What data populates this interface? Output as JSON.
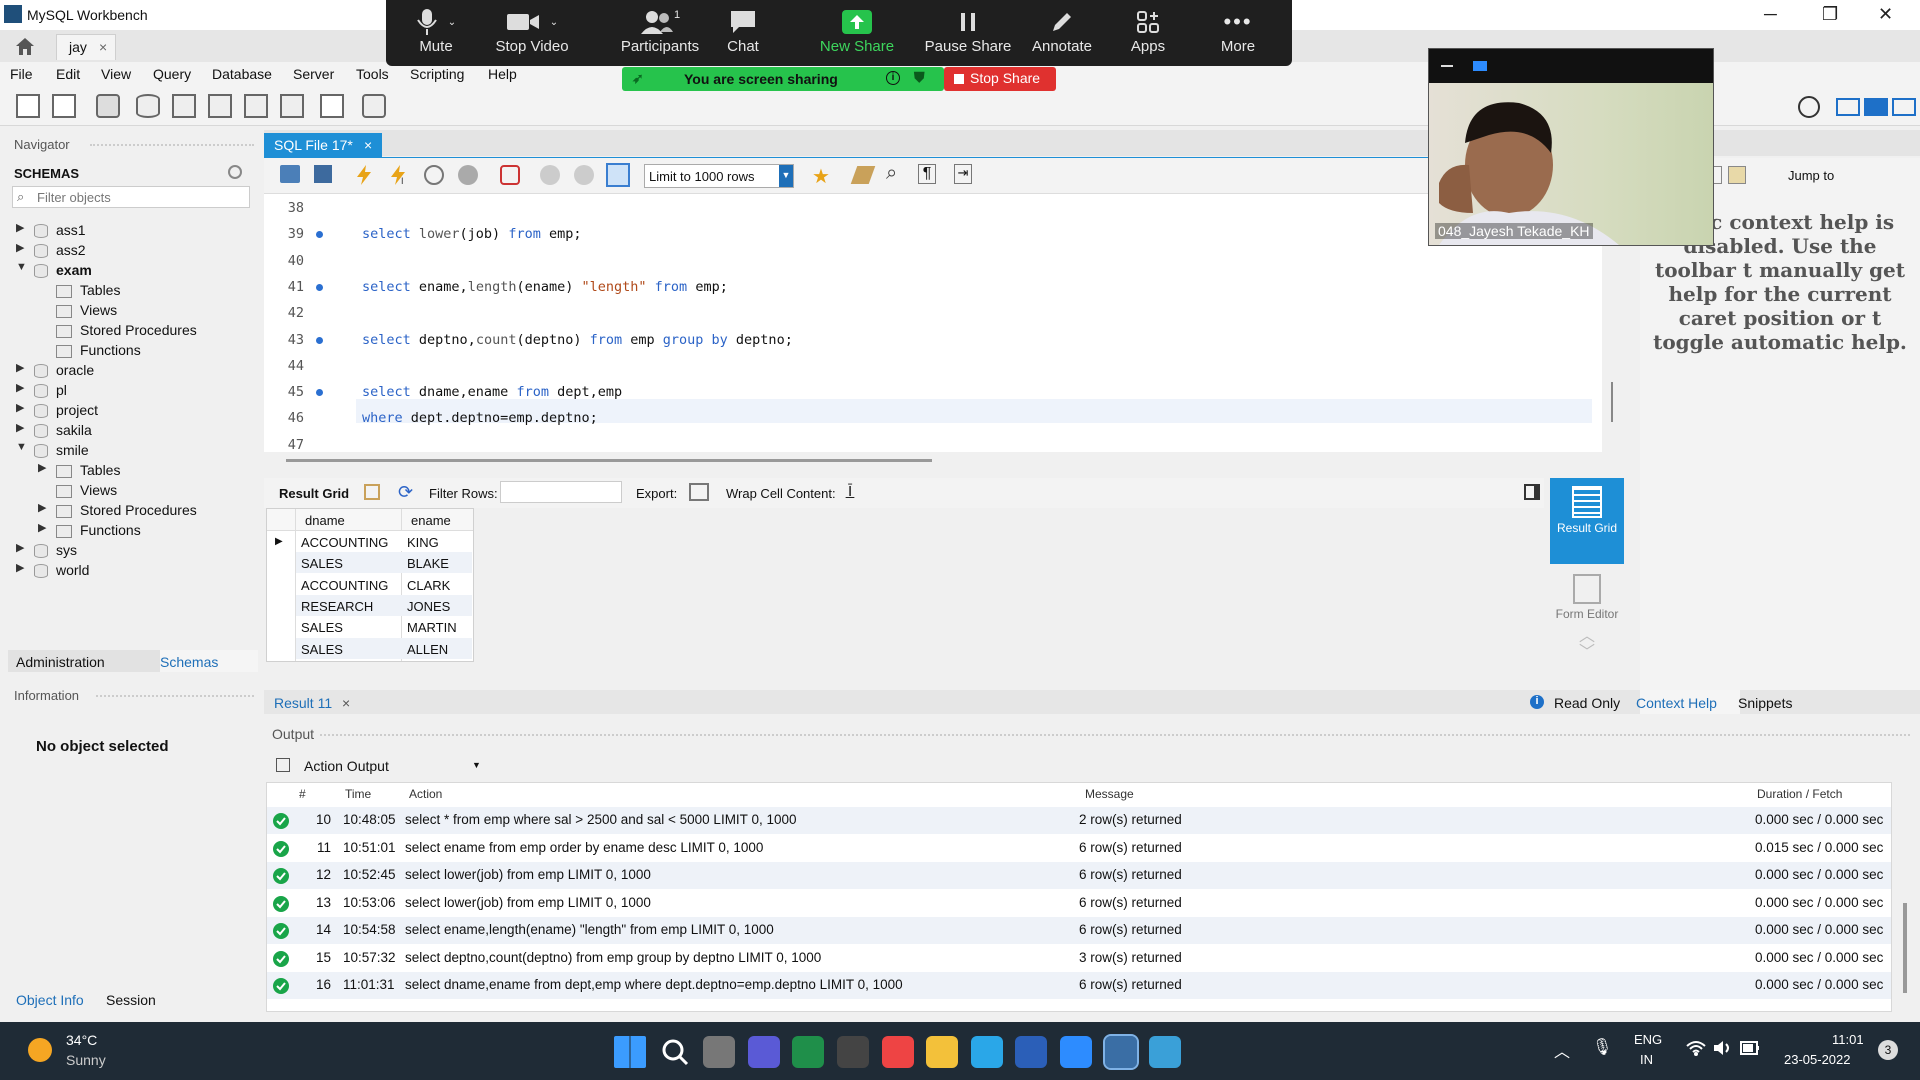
{
  "window": {
    "title": "MySQL Workbench",
    "conn_tab": "jay"
  },
  "zoom": {
    "buttons": [
      "Mute",
      "Stop Video",
      "Participants",
      "Chat",
      "New Share",
      "Pause Share",
      "Annotate",
      "Apps",
      "More"
    ],
    "participants_count": "1",
    "sharing_text": "You are screen sharing",
    "stop_share": "Stop Share",
    "video_name": "048_Jayesh Tekade_KH"
  },
  "menu": [
    "File",
    "Edit",
    "View",
    "Query",
    "Database",
    "Server",
    "Tools",
    "Scripting",
    "Help"
  ],
  "navigator": {
    "header": "Navigator",
    "schemas_label": "SCHEMAS",
    "filter_placeholder": "Filter objects",
    "tree": [
      {
        "label": "ass1",
        "type": "db",
        "arrow": "▶"
      },
      {
        "label": "ass2",
        "type": "db",
        "arrow": "▶"
      },
      {
        "label": "exam",
        "type": "db",
        "arrow": "▼",
        "bold": true
      },
      {
        "label": "Tables",
        "type": "folder",
        "arrow": ""
      },
      {
        "label": "Views",
        "type": "folder",
        "arrow": ""
      },
      {
        "label": "Stored Procedures",
        "type": "folder",
        "arrow": ""
      },
      {
        "label": "Functions",
        "type": "folder",
        "arrow": ""
      },
      {
        "label": "oracle",
        "type": "db",
        "arrow": "▶"
      },
      {
        "label": "pl",
        "type": "db",
        "arrow": "▶"
      },
      {
        "label": "project",
        "type": "db",
        "arrow": "▶"
      },
      {
        "label": "sakila",
        "type": "db",
        "arrow": "▶"
      },
      {
        "label": "smile",
        "type": "db",
        "arrow": "▼"
      },
      {
        "label": "Tables",
        "type": "folder",
        "arrow": "▶"
      },
      {
        "label": "Views",
        "type": "folder",
        "arrow": ""
      },
      {
        "label": "Stored Procedures",
        "type": "folder",
        "arrow": "▶"
      },
      {
        "label": "Functions",
        "type": "folder",
        "arrow": "▶"
      },
      {
        "label": "sys",
        "type": "db",
        "arrow": "▶"
      },
      {
        "label": "world",
        "type": "db",
        "arrow": "▶"
      }
    ],
    "tabs": [
      "Administration",
      "Schemas"
    ],
    "info_header": "Information",
    "no_object": "No object selected",
    "bottom_tabs": [
      "Object Info",
      "Session"
    ]
  },
  "editor": {
    "tab": "SQL File 17*",
    "limit": "Limit to 1000 rows",
    "jump_to": "Jump to",
    "lines": [
      {
        "n": "38",
        "dot": false,
        "code": []
      },
      {
        "n": "39",
        "dot": true,
        "code": [
          [
            "kw",
            "select "
          ],
          [
            "fn",
            "lower"
          ],
          [
            "t",
            "(job) "
          ],
          [
            "kw",
            "from"
          ],
          [
            "t",
            " emp;"
          ]
        ]
      },
      {
        "n": "40",
        "dot": false,
        "code": []
      },
      {
        "n": "41",
        "dot": true,
        "code": [
          [
            "kw",
            "select "
          ],
          [
            "t",
            "ename,"
          ],
          [
            "fn",
            "length"
          ],
          [
            "t",
            "(ename) "
          ],
          [
            "str",
            "\"length\""
          ],
          [
            "t",
            " "
          ],
          [
            "kw",
            "from"
          ],
          [
            "t",
            " emp;"
          ]
        ]
      },
      {
        "n": "42",
        "dot": false,
        "code": []
      },
      {
        "n": "43",
        "dot": true,
        "code": [
          [
            "kw",
            "select "
          ],
          [
            "t",
            "deptno,"
          ],
          [
            "fn",
            "count"
          ],
          [
            "t",
            "(deptno) "
          ],
          [
            "kw",
            "from"
          ],
          [
            "t",
            " emp "
          ],
          [
            "kw",
            "group by"
          ],
          [
            "t",
            " deptno;"
          ]
        ]
      },
      {
        "n": "44",
        "dot": false,
        "code": []
      },
      {
        "n": "45",
        "dot": true,
        "code": [
          [
            "kw",
            "select "
          ],
          [
            "t",
            "dname,ename "
          ],
          [
            "kw",
            "from"
          ],
          [
            "t",
            " dept,emp"
          ]
        ]
      },
      {
        "n": "46",
        "dot": false,
        "code": [
          [
            "kw",
            "where "
          ],
          [
            "t",
            "dept.deptno=emp.deptno;"
          ]
        ]
      },
      {
        "n": "47",
        "dot": false,
        "code": []
      }
    ]
  },
  "result": {
    "toolbar": {
      "grid": "Result Grid",
      "filter": "Filter Rows:",
      "export": "Export:",
      "wrap": "Wrap Cell Content:"
    },
    "columns": [
      "dname",
      "ename"
    ],
    "rows": [
      [
        "ACCOUNTING",
        "KING"
      ],
      [
        "SALES",
        "BLAKE"
      ],
      [
        "ACCOUNTING",
        "CLARK"
      ],
      [
        "RESEARCH",
        "JONES"
      ],
      [
        "SALES",
        "MARTIN"
      ],
      [
        "SALES",
        "ALLEN"
      ]
    ],
    "side": {
      "grid": "Result Grid",
      "form": "Form Editor"
    },
    "tab": "Result 11",
    "read_only": "Read Only",
    "right_tabs": [
      "Context Help",
      "Snippets"
    ]
  },
  "context_help": "natic context help is disabled. Use the toolbar t manually get help for the current caret position or t toggle automatic help.",
  "output": {
    "header": "Output",
    "select": "Action Output",
    "columns": [
      "#",
      "Time",
      "Action",
      "Message",
      "Duration / Fetch"
    ],
    "rows": [
      [
        "10",
        "10:48:05",
        "select * from emp where sal > 2500 and sal < 5000 LIMIT 0, 1000",
        "2 row(s) returned",
        "0.000 sec / 0.000 sec"
      ],
      [
        "11",
        "10:51:01",
        "select ename from emp order by ename desc LIMIT 0, 1000",
        "6 row(s) returned",
        "0.015 sec / 0.000 sec"
      ],
      [
        "12",
        "10:52:45",
        "select lower(job) from emp LIMIT 0, 1000",
        "6 row(s) returned",
        "0.000 sec / 0.000 sec"
      ],
      [
        "13",
        "10:53:06",
        "select lower(job) from emp LIMIT 0, 1000",
        "6 row(s) returned",
        "0.000 sec / 0.000 sec"
      ],
      [
        "14",
        "10:54:58",
        "select ename,length(ename) \"length\" from emp LIMIT 0, 1000",
        "6 row(s) returned",
        "0.000 sec / 0.000 sec"
      ],
      [
        "15",
        "10:57:32",
        "select deptno,count(deptno) from emp group by deptno LIMIT 0, 1000",
        "3 row(s) returned",
        "0.000 sec / 0.000 sec"
      ],
      [
        "16",
        "11:01:31",
        "select dname,ename from dept,emp   where dept.deptno=emp.deptno LIMIT 0, 1000",
        "6 row(s) returned",
        "0.000 sec / 0.000 sec"
      ]
    ]
  },
  "taskbar": {
    "temp": "34°C",
    "weather": "Sunny",
    "lang1": "ENG",
    "lang2": "IN",
    "time": "11:01",
    "date": "23-05-2022",
    "notif": "3",
    "apps": [
      "start-icon",
      "search-icon",
      "task-view-icon",
      "teams-chat-icon",
      "excel-icon",
      "store-icon",
      "chrome-icon",
      "file-explorer-icon",
      "skype-icon",
      "word-icon",
      "zoom-icon",
      "mysql-workbench-icon",
      "notepad-icon"
    ]
  },
  "colors": {
    "accent": "#1e8fd6",
    "share_green": "#26c34c",
    "stop_red": "#e0312f",
    "keyword": "#2b63c7",
    "ok_green": "#19a549"
  }
}
